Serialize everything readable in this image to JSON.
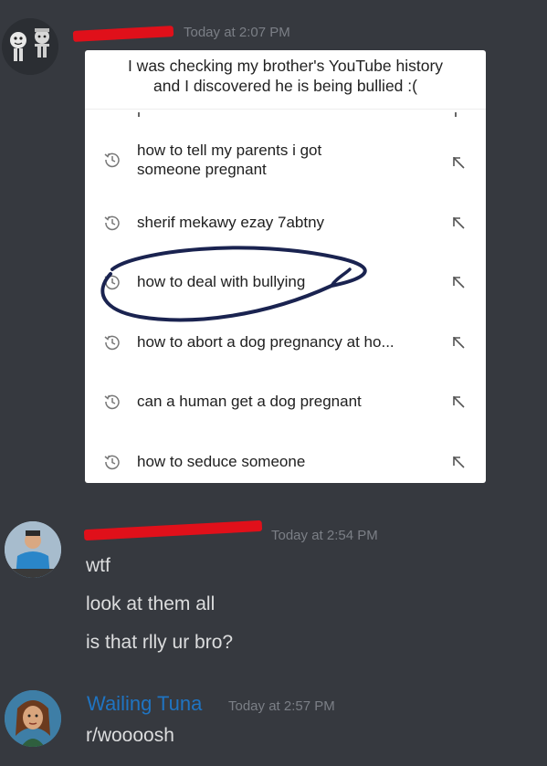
{
  "messages": [
    {
      "timestamp": "Today at 2:07 PM",
      "image": {
        "caption_line1": "I was checking my brother's YouTube history",
        "caption_line2": "and I discovered he is being bullied :(",
        "search_items": [
          {
            "line1": "how to tell my parents i got",
            "line2": "someone pregnant"
          },
          {
            "line1": "sherif mekawy ezay 7abtny",
            "line2": ""
          },
          {
            "line1": "how to deal with bullying",
            "line2": ""
          },
          {
            "line1": "how to abort a dog pregnancy at ho...",
            "line2": ""
          },
          {
            "line1": "can a human get a dog pregnant",
            "line2": ""
          },
          {
            "line1": "how to seduce someone",
            "line2": ""
          }
        ]
      }
    },
    {
      "timestamp": "Today at 2:54 PM",
      "lines": [
        "wtf",
        "look at them all",
        "is that rlly ur bro?"
      ]
    },
    {
      "username": "Wailing Tuna",
      "timestamp": "Today at 2:57 PM",
      "lines": [
        "r/woooosh"
      ]
    }
  ],
  "colors": {
    "background": "#36393f",
    "redaction": "#e0101a",
    "username_blue": "#1f74c2",
    "timestamp": "#7b7f86",
    "text": "#dcddde",
    "annotation": "#1a2350"
  },
  "icons": {
    "history": "history-clock-icon",
    "fill_query": "arrow-up-left-icon"
  }
}
